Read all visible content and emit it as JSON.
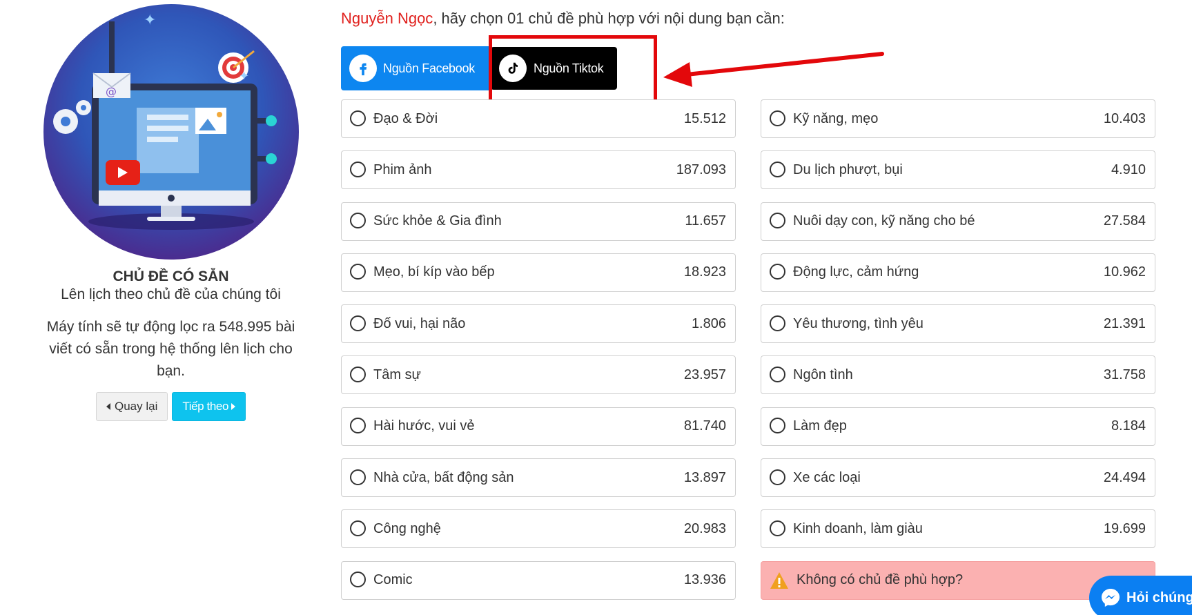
{
  "left": {
    "heading": "CHỦ ĐỀ CÓ SẴN",
    "subheading": "Lên lịch theo chủ đề của chúng tôi",
    "description": "Máy tính sẽ tự động lọc ra 548.995 bài viết có sẵn trong hệ thống lên lịch cho bạn.",
    "back_label": "Quay lại",
    "next_label": "Tiếp theo"
  },
  "prompt": {
    "user_name": "Nguyễn Ngọc",
    "text": ", hãy chọn 01 chủ đề phù hợp với nội dung bạn cần:"
  },
  "tabs": {
    "facebook_label": "Nguồn Facebook",
    "tiktok_label": "Nguồn Tiktok"
  },
  "topics_left": [
    {
      "label": "Đạo & Đời",
      "count": "15.512"
    },
    {
      "label": "Phim ảnh",
      "count": "187.093"
    },
    {
      "label": "Sức khỏe & Gia đình",
      "count": "11.657"
    },
    {
      "label": "Mẹo, bí kíp vào bếp",
      "count": "18.923"
    },
    {
      "label": "Đố vui, hại não",
      "count": "1.806"
    },
    {
      "label": "Tâm sự",
      "count": "23.957"
    },
    {
      "label": "Hài hước, vui vẻ",
      "count": "81.740"
    },
    {
      "label": "Nhà cửa, bất động sản",
      "count": "13.897"
    },
    {
      "label": "Công nghệ",
      "count": "20.983"
    },
    {
      "label": "Comic",
      "count": "13.936"
    }
  ],
  "topics_right": [
    {
      "label": "Kỹ năng, mẹo",
      "count": "10.403"
    },
    {
      "label": "Du lịch phượt, bụi",
      "count": "4.910"
    },
    {
      "label": "Nuôi dạy con, kỹ năng cho bé",
      "count": "27.584"
    },
    {
      "label": "Động lực, cảm hứng",
      "count": "10.962"
    },
    {
      "label": "Yêu thương, tình yêu",
      "count": "21.391"
    },
    {
      "label": "Ngôn tình",
      "count": "31.758"
    },
    {
      "label": "Làm đẹp",
      "count": "8.184"
    },
    {
      "label": "Xe các loại",
      "count": "24.494"
    },
    {
      "label": "Kinh doanh, làm giàu",
      "count": "19.699"
    }
  ],
  "no_topic_label": "Không có chủ đề phù hợp?",
  "chat": {
    "label": "Hỏi chúng"
  },
  "colors": {
    "accent_blue": "#0ec3ee",
    "facebook_blue": "#0d86f0",
    "tiktok_black": "#000000",
    "highlight_red": "#e3080b",
    "warning_bg": "#fbb1b1",
    "name_red": "#e0201d"
  },
  "icons": {
    "facebook": "facebook-icon",
    "tiktok": "tiktok-icon",
    "warning": "warning-icon",
    "messenger": "messenger-icon"
  }
}
